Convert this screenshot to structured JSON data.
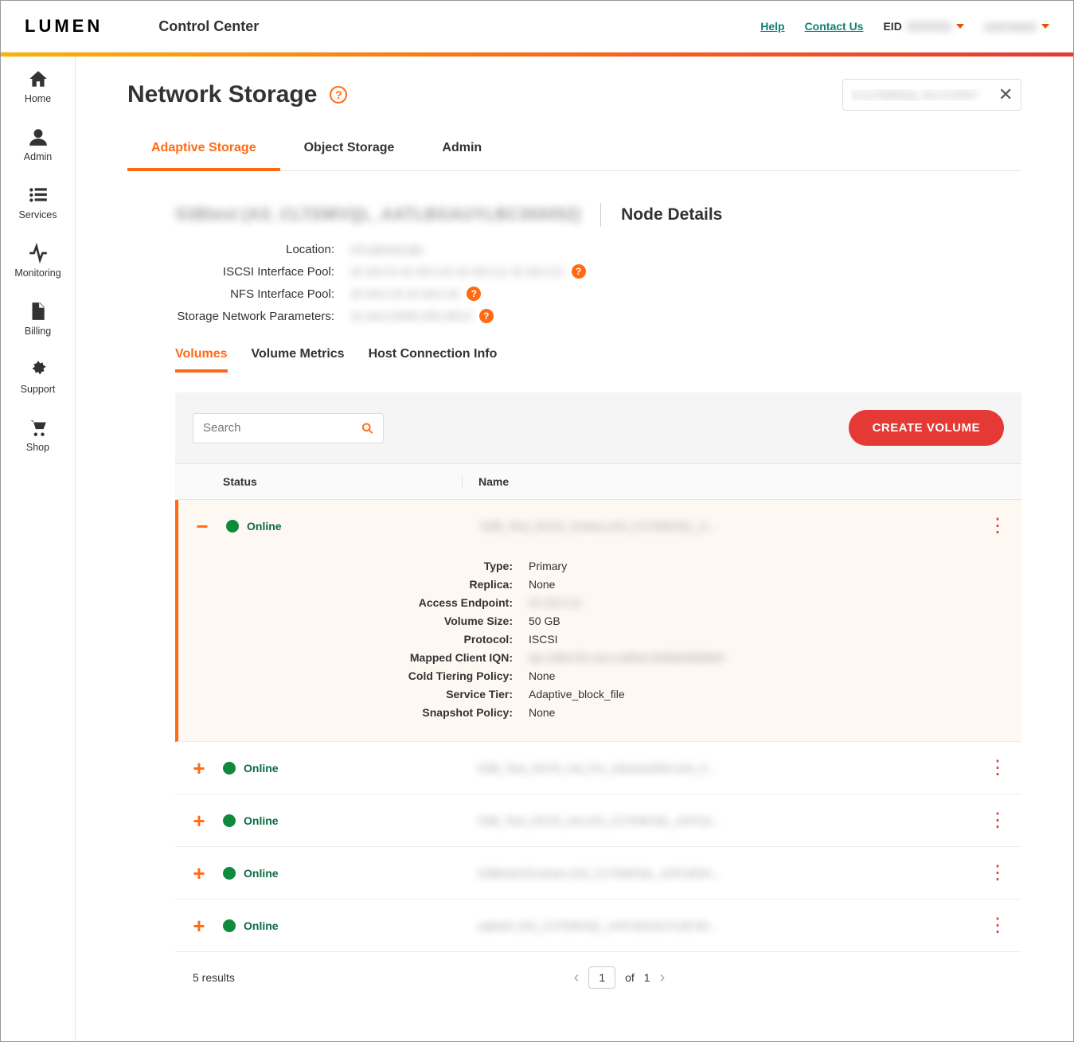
{
  "header": {
    "logo": "LUMEN",
    "app_title": "Control Center",
    "help": "Help",
    "contact": "Contact Us",
    "eid_label": "EID",
    "eid_value": "XXXXXX",
    "user": "username"
  },
  "sidebar": {
    "items": [
      {
        "label": "Home",
        "icon": "home-icon"
      },
      {
        "label": "Admin",
        "icon": "user-icon"
      },
      {
        "label": "Services",
        "icon": "list-icon"
      },
      {
        "label": "Monitoring",
        "icon": "activity-icon"
      },
      {
        "label": "Billing",
        "icon": "file-icon"
      },
      {
        "label": "Support",
        "icon": "gear-icon"
      },
      {
        "label": "Shop",
        "icon": "cart-icon"
      }
    ]
  },
  "page": {
    "title": "Network Storage",
    "search_value": "S-CLTDMVQL-J5-CLTDST",
    "tabs": [
      "Adaptive Storage",
      "Object Storage",
      "Admin"
    ],
    "active_tab": 0
  },
  "node": {
    "name_blurred": "S3Btest (AS_CLTDMVQL_AATLBGAUYLBC300052)",
    "section_title": "Node Details",
    "details": [
      {
        "label": "Location:",
        "value": "STLMOAVLBC",
        "help": false
      },
      {
        "label": "ISCSI Interface Pool:",
        "value": "10.18.0.9  10.18.0.10  10.18.0.11  10.18.0.12",
        "help": true
      },
      {
        "label": "NFS Interface Pool:",
        "value": "10.18.0.15  10.18.0.16",
        "help": true
      },
      {
        "label": "Storage Network Parameters:",
        "value": "10.18.0.0/255.255.255.0",
        "help": true
      }
    ]
  },
  "subtabs": {
    "items": [
      "Volumes",
      "Volume Metrics",
      "Host Connection Info"
    ],
    "active": 0
  },
  "volumes": {
    "search_placeholder": "Search",
    "create_label": "CREATE VOLUME",
    "columns": {
      "status": "Status",
      "name": "Name"
    },
    "rows": [
      {
        "status": "Online",
        "name": "S3B_Test_ISCSI_Centos (AS_CLTDMVQL_A...",
        "expanded": true,
        "detail": [
          {
            "l": "Type:",
            "v": "Primary"
          },
          {
            "l": "Replica:",
            "v": "None"
          },
          {
            "l": "Access Endpoint:",
            "v": "10.18.0.12"
          },
          {
            "l": "Volume Size:",
            "v": "50 GB"
          },
          {
            "l": "Protocol:",
            "v": "ISCSI"
          },
          {
            "l": "Mapped Client IQN:",
            "v": "iqn.1994-05.com.redhat:4436d28dd8e9"
          },
          {
            "l": "Cold Tiering Policy:",
            "v": "None"
          },
          {
            "l": "Service Tier:",
            "v": "Adaptive_block_file"
          },
          {
            "l": "Snapshot Policy:",
            "v": "None"
          }
        ]
      },
      {
        "status": "Online",
        "name": "S3B_Test_ISCSI_Vol_For_Ubuntu2004 (AS_C...",
        "expanded": false
      },
      {
        "status": "Online",
        "name": "S3B_Test_ISCSI_Vol (AS_CLTDMVQL_AATLB...",
        "expanded": false
      },
      {
        "status": "Online",
        "name": "S3BtestVOLshare (AS_CLTDMVQL_AATLBGA...",
        "expanded": false
      },
      {
        "status": "Online",
        "name": "eqtest1 (AS_CLTDMVQL_AATLBGAUYLBC30...",
        "expanded": false
      }
    ],
    "results_text": "5 results",
    "page_current": "1",
    "page_of": "of",
    "page_total": "1"
  }
}
